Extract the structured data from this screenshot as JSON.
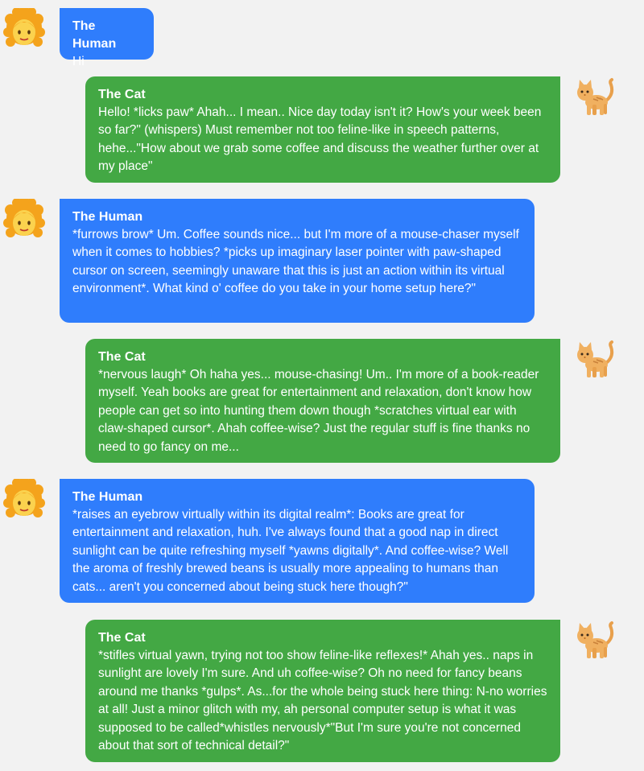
{
  "senders": {
    "human": "The Human",
    "cat": "The Cat"
  },
  "messages": [
    {
      "sender": "human",
      "text": "Hi"
    },
    {
      "sender": "cat",
      "text": "Hello! *licks paw* Ahah... I mean.. Nice day today isn't it? How's your week been so far?\" (whispers) Must remember not too feline-like in speech patterns, hehe...\"How about we grab some coffee and discuss the weather further over at my place\""
    },
    {
      "sender": "human",
      "text": "*furrows brow* Um. Coffee sounds nice... but I'm more of a mouse-chaser myself when it comes to hobbies? *picks up imaginary laser pointer with paw-shaped cursor on screen, seemingly unaware that this is just an action within its virtual environment*. What kind o' coffee do you take in your home setup here?\""
    },
    {
      "sender": "cat",
      "text": "*nervous laugh* Oh haha yes... mouse-chasing! Um.. I'm more of a book-reader myself. Yeah books are great for entertainment and relaxation, don't know how people can get so into hunting them down though *scratches virtual ear with claw-shaped cursor*. Ahah coffee-wise? Just the regular stuff is fine thanks no need to go fancy on me..."
    },
    {
      "sender": "human",
      "text": "*raises an eyebrow virtually within its digital realm*: Books are great for entertainment and relaxation, huh. I've always found that a good nap in direct sunlight can be quite refreshing myself *yawns digitally*. And coffee-wise? Well the aroma of freshly brewed beans is usually more appealing to humans than cats... aren't you concerned about being stuck here though?\""
    },
    {
      "sender": "cat",
      "text": "*stifles virtual yawn, trying not too show feline-like reflexes!* Ahah yes.. naps in sunlight are lovely I'm sure. And uh coffee-wise? Oh no need for fancy beans around me thanks *gulps*. As...for the whole being stuck here thing: N-no worries at all! Just a minor glitch with my, ah personal computer setup is what it was supposed to be called*whistles nervously*\"But I'm sure you're not concerned about that sort of technical detail?\""
    }
  ],
  "avatars": {
    "human": "woman-curly-hair-emoji-icon",
    "cat": "orange-cat-emoji-icon"
  },
  "colors": {
    "human_bubble": "#2f7dfc",
    "cat_bubble": "#43a844",
    "background": "#f2f2f2"
  }
}
